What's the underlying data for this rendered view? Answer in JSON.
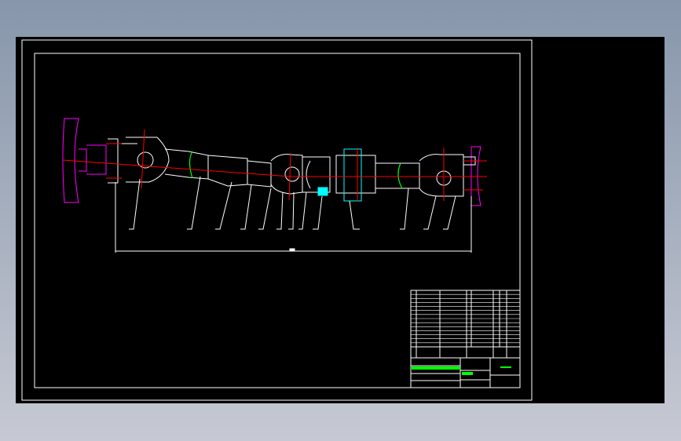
{
  "viewer": {
    "background": "#000000"
  },
  "drawing": {
    "colors": {
      "outline": "#ffffff",
      "centerline": "#ff0000",
      "flange": "#ff00ff",
      "section": "#00ffff",
      "break_line": "#00ff00"
    },
    "balloon_count": 13,
    "title_block": {
      "parts_list_rows": 14
    }
  }
}
